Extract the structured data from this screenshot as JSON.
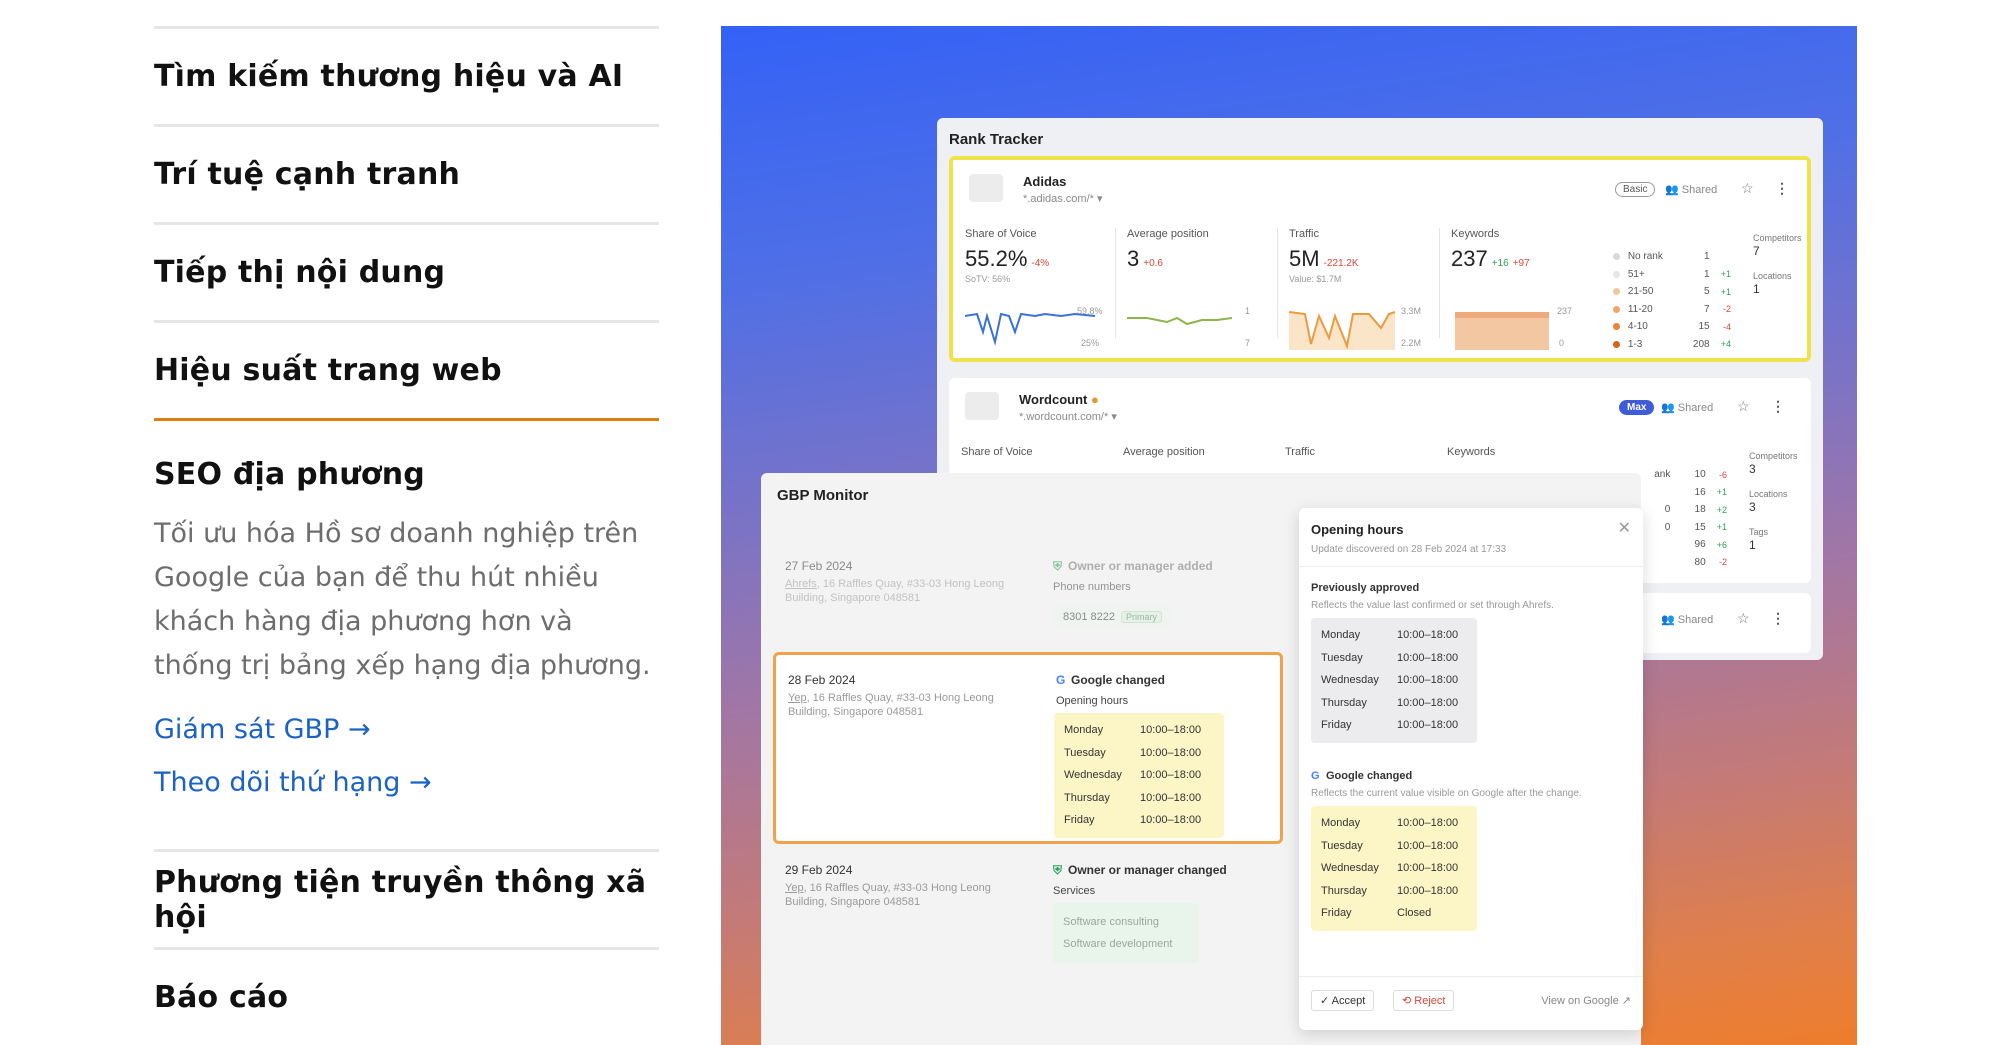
{
  "accordion": {
    "items": [
      {
        "title": "Tìm kiếm thương hiệu và AI"
      },
      {
        "title": "Trí tuệ cạnh tranh"
      },
      {
        "title": "Tiếp thị nội dung"
      },
      {
        "title": "Hiệu suất trang web"
      }
    ],
    "active": {
      "title": "SEO địa phương",
      "description": "Tối ưu hóa Hồ sơ doanh nghiệp trên Google của bạn để thu hút nhiều khách hàng địa phương hơn và thống trị bảng xếp hạng địa phương.",
      "links": [
        "Giám sát GBP →",
        "Theo dõi thứ hạng →"
      ]
    },
    "after": [
      {
        "title": "Phương tiện truyền thông xã hội"
      },
      {
        "title": "Báo cáo"
      }
    ]
  },
  "rank_tracker": {
    "title": "Rank Tracker",
    "project1": {
      "name": "Adidas",
      "url": "*.adidas.com/* ▾",
      "badge": "Basic",
      "shared": "Shared",
      "metrics": [
        {
          "label": "Share of Voice",
          "value": "55.2%",
          "delta": "-4%",
          "sub": "SoTV: 56%",
          "max": "59.8%",
          "min": "25%"
        },
        {
          "label": "Average position",
          "value": "3",
          "delta": "+0.6",
          "sub": "",
          "max": "1",
          "min": "7"
        },
        {
          "label": "Traffic",
          "value": "5M",
          "delta": "-221.2K",
          "sub": "Value: $1.7M",
          "max": "3.3M",
          "min": "2.2M"
        },
        {
          "label": "Keywords",
          "value": "237",
          "delta_up": "+16",
          "delta": "+97",
          "sub": "",
          "max": "237",
          "min": "0"
        }
      ],
      "ranks": [
        {
          "label": "No rank",
          "num": "1",
          "d": "",
          "color": "#d9d9d9"
        },
        {
          "label": "51+",
          "num": "1",
          "d": "+1",
          "color": "#e6e6e6"
        },
        {
          "label": "21-50",
          "num": "5",
          "d": "+1",
          "color": "#f2c89a"
        },
        {
          "label": "11-20",
          "num": "7",
          "d": "-2",
          "color": "#f0a66a"
        },
        {
          "label": "4-10",
          "num": "15",
          "d": "-4",
          "color": "#e8843e"
        },
        {
          "label": "1-3",
          "num": "208",
          "d": "+4",
          "color": "#d8641c"
        }
      ],
      "competitors_label": "Competitors",
      "competitors": "7",
      "locations_label": "Locations",
      "locations": "1"
    },
    "project2": {
      "name": "Wordcount",
      "url": "*.wordcount.com/* ▾",
      "badge": "Max",
      "shared": "Shared",
      "metric_labels": [
        "Share of Voice",
        "Average position",
        "Traffic",
        "Keywords"
      ],
      "ranks_partial": [
        {
          "label": "ank",
          "num": "10",
          "d": "-6"
        },
        {
          "label": "",
          "num": "16",
          "d": "+1"
        },
        {
          "label": "0",
          "num": "18",
          "d": "+2"
        },
        {
          "label": "0",
          "num": "15",
          "d": "+1"
        },
        {
          "label": "",
          "num": "96",
          "d": "+6"
        },
        {
          "label": "",
          "num": "80",
          "d": "-2"
        }
      ],
      "competitors_label": "Competitors",
      "competitors": "3",
      "locations_label": "Locations",
      "locations": "3",
      "tags_label": "Tags",
      "tags": "1"
    },
    "project3_shared": "Shared"
  },
  "gbp_monitor": {
    "title": "GBP Monitor",
    "entries": [
      {
        "date": "27 Feb 2024",
        "addr_prefix": "Ahrefs",
        "addr": ", 16 Raffles Quay, #33-03 Hong Leong Building, Singapore 048581",
        "change": "Owner or manager added",
        "change_sub": "Phone numbers",
        "phone": "8301 8222",
        "phone_tag": "Primary"
      },
      {
        "date": "28 Feb 2024",
        "addr_prefix": "Yep",
        "addr": ", 16 Raffles Quay, #33-03 Hong Leong Building, Singapore 048581",
        "change": "Google changed",
        "change_sub": "Opening hours",
        "hours": [
          {
            "day": "Monday",
            "time": "10:00–18:00"
          },
          {
            "day": "Tuesday",
            "time": "10:00–18:00"
          },
          {
            "day": "Wednesday",
            "time": "10:00–18:00"
          },
          {
            "day": "Thursday",
            "time": "10:00–18:00"
          },
          {
            "day": "Friday",
            "time": "10:00–18:00"
          }
        ]
      },
      {
        "date": "29 Feb 2024",
        "addr_prefix": "Yep",
        "addr": ", 16 Raffles Quay, #33-03 Hong Leong Building, Singapore 048581",
        "change": "Owner or manager changed",
        "change_sub": "Services",
        "services": [
          "Software consulting",
          "Software development"
        ]
      }
    ]
  },
  "opening_hours": {
    "title": "Opening hours",
    "close": "✕",
    "subtitle": "Update discovered on 28 Feb 2024 at 17:33",
    "prev_title": "Previously approved",
    "prev_note": "Reflects the value last confirmed or set through Ahrefs.",
    "prev_hours": [
      {
        "day": "Monday",
        "time": "10:00–18:00"
      },
      {
        "day": "Tuesday",
        "time": "10:00–18:00"
      },
      {
        "day": "Wednesday",
        "time": "10:00–18:00"
      },
      {
        "day": "Thursday",
        "time": "10:00–18:00"
      },
      {
        "day": "Friday",
        "time": "10:00–18:00"
      }
    ],
    "new_title": "Google changed",
    "new_note": "Reflects the current value visible on Google after the change.",
    "new_hours": [
      {
        "day": "Monday",
        "time": "10:00–18:00"
      },
      {
        "day": "Tuesday",
        "time": "10:00–18:00"
      },
      {
        "day": "Wednesday",
        "time": "10:00–18:00"
      },
      {
        "day": "Thursday",
        "time": "10:00–18:00"
      },
      {
        "day": "Friday",
        "time": "Closed"
      }
    ],
    "accept": "✓ Accept",
    "reject": "⟲ Reject",
    "view_google": "View on Google ↗"
  },
  "colors": {
    "accent_orange": "#e07f10",
    "link_blue": "#1b62c4",
    "highlight_yellow": "#f0e34a"
  }
}
